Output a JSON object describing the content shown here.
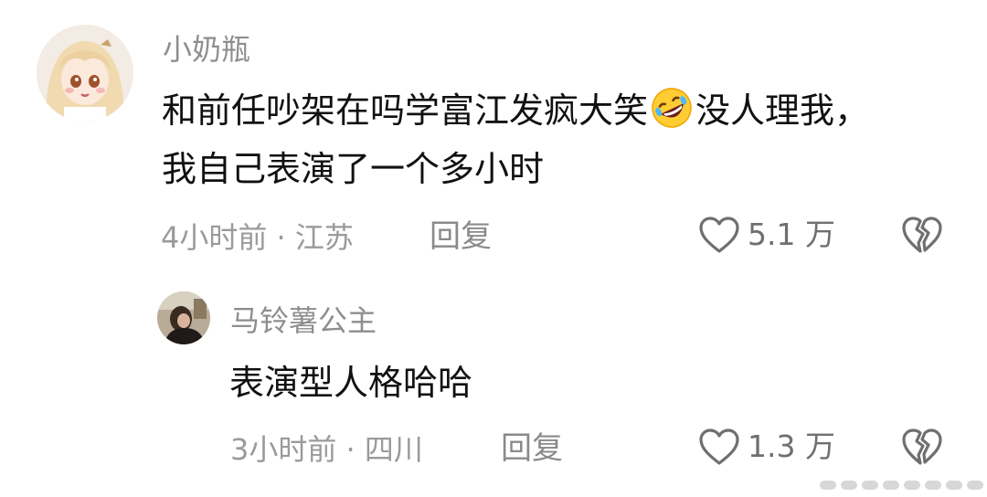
{
  "comments": [
    {
      "username": "小奶瓶",
      "text_before_emoji": "和前任吵架在吗学富江发疯大笑",
      "emoji": "rofl-emoji",
      "text_after_emoji": "没人理我，",
      "text_line2": "我自己表演了一个多小时",
      "time": "4小时前",
      "separator": "·",
      "location": "江苏",
      "reply_label": "回复",
      "like_count": "5.1 万",
      "like_icon": "heart-outline-icon",
      "dislike_icon": "broken-heart-outline-icon",
      "avatar": "anime-girl-avatar"
    },
    {
      "username": "马铃薯公主",
      "text": "表演型人格哈哈",
      "time": "3小时前",
      "separator": "·",
      "location": "四川",
      "reply_label": "回复",
      "like_count": "1.3 万",
      "like_icon": "heart-outline-icon",
      "dislike_icon": "broken-heart-outline-icon",
      "avatar": "photo-avatar"
    }
  ],
  "colors": {
    "text_primary": "#111111",
    "text_secondary": "#8e8e8e",
    "icon": "#6f6f6f",
    "background": "#ffffff"
  }
}
